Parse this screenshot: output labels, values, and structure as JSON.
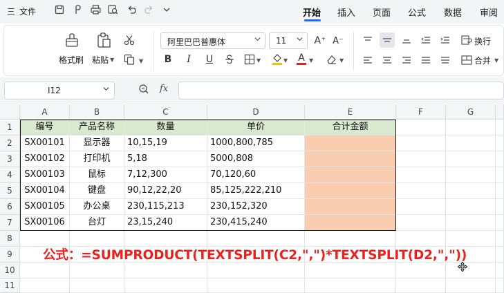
{
  "menu": {
    "hamburger_label": "三",
    "file_label": "文件",
    "tabs": [
      {
        "label": "开始",
        "active": true
      },
      {
        "label": "插入",
        "active": false
      },
      {
        "label": "页面",
        "active": false
      },
      {
        "label": "公式",
        "active": false
      },
      {
        "label": "数据",
        "active": false
      },
      {
        "label": "审阅",
        "active": false
      }
    ]
  },
  "ribbon": {
    "format_painter_label": "格式刷",
    "paste_label": "粘贴",
    "font_name": "阿里巴巴普惠体",
    "font_size": "11",
    "wrap_label": "换行",
    "merge_label": "合并",
    "bold_label": "B",
    "italic_label": "I",
    "underline_label": "U",
    "font_color_label": "A",
    "grow_font_label": "A⁺",
    "shrink_font_label": "A⁻",
    "accent_color": "#1b6ef3",
    "font_color_bar": "#e8221d",
    "fill_color_bar": "#f5c400"
  },
  "formula_bar": {
    "cell_ref": "I12",
    "fx_label": "fx",
    "content": ""
  },
  "sheet": {
    "columns": [
      "A",
      "B",
      "C",
      "D",
      "E",
      "F",
      "G"
    ],
    "rows": [
      "1",
      "2",
      "3",
      "4",
      "5",
      "6",
      "7",
      "8",
      "9",
      "10",
      "11"
    ],
    "header": [
      "编号",
      "产品名称",
      "数量",
      "单价",
      "合计金额"
    ],
    "data": [
      [
        "SX00101",
        "显示器",
        "10,15,19",
        "1000,800,785",
        ""
      ],
      [
        "SX00102",
        "打印机",
        "5,18",
        "5000,808",
        ""
      ],
      [
        "SX00103",
        "鼠标",
        "7,12,300",
        "70,120,60",
        ""
      ],
      [
        "SX00104",
        "键盘",
        "90,12,22,20",
        "85,125,222,210",
        ""
      ],
      [
        "SX00105",
        "办公桌",
        "230,115,213",
        "230,152,320",
        ""
      ],
      [
        "SX00106",
        "台灯",
        "23,15,240",
        "230,415,240",
        ""
      ]
    ],
    "header_fill": "#d9e9cf",
    "result_fill": "#f9cdb0",
    "formula_note": "公式：=SUMPRODUCT(TEXTSPLIT(C2,\",\")*TEXTSPLIT(D2,\",\"))",
    "formula_note_color": "#e8221d"
  }
}
